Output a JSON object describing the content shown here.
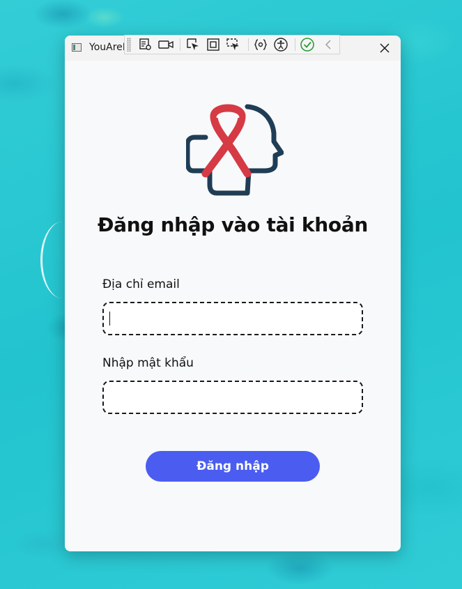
{
  "window": {
    "title": "YouAreI"
  },
  "logo": {
    "icon": "ribbon-head-logo-icon",
    "colors": {
      "ribbon": "#d63a45",
      "head": "#1f3d55"
    }
  },
  "dev_toolbar": {
    "tools": [
      "select-element-icon",
      "record-icon",
      "pointer-select-icon",
      "display-layout-icon",
      "track-focus-icon",
      "binding-failures-icon",
      "accessibility-icon",
      "checkmark-icon",
      "collapse-icon"
    ]
  },
  "form": {
    "heading": "Đăng nhập vào tài khoản",
    "email": {
      "label": "Địa chỉ email",
      "value": ""
    },
    "password": {
      "label": "Nhập mật khẩu",
      "value": ""
    },
    "submit_label": "Đăng nhập"
  },
  "colors": {
    "accent": "#4a5df0",
    "background": "#2bc9d3"
  }
}
